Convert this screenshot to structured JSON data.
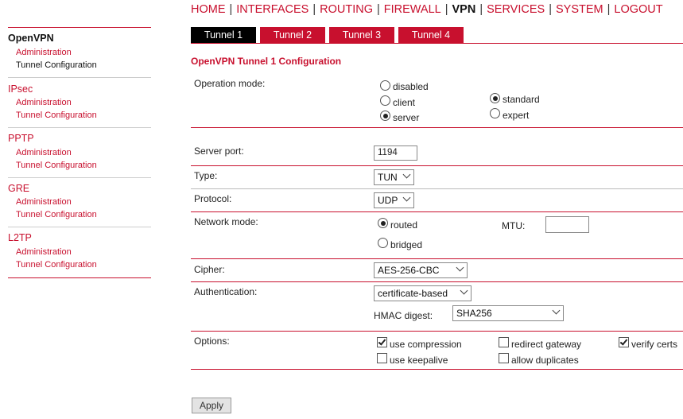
{
  "nav": {
    "items": [
      "HOME",
      "INTERFACES",
      "ROUTING",
      "FIREWALL",
      "VPN",
      "SERVICES",
      "SYSTEM",
      "LOGOUT"
    ],
    "active": "VPN"
  },
  "sidebar": {
    "openvpn": {
      "title": "OpenVPN",
      "admin": "Administration",
      "tunnel": "Tunnel Configuration"
    },
    "ipsec": {
      "title": "IPsec",
      "admin": "Administration",
      "tunnel": "Tunnel Configuration"
    },
    "pptp": {
      "title": "PPTP",
      "admin": "Administration",
      "tunnel": "Tunnel Configuration"
    },
    "gre": {
      "title": "GRE",
      "admin": "Administration",
      "tunnel": "Tunnel Configuration"
    },
    "l2tp": {
      "title": "L2TP",
      "admin": "Administration",
      "tunnel": "Tunnel Configuration"
    }
  },
  "tabs": [
    "Tunnel 1",
    "Tunnel 2",
    "Tunnel 3",
    "Tunnel 4"
  ],
  "page_title": "OpenVPN Tunnel 1 Configuration",
  "form": {
    "operation_mode": {
      "label": "Operation mode:",
      "disabled": "disabled",
      "client": "client",
      "server": "server",
      "standard": "standard",
      "expert": "expert"
    },
    "server_port": {
      "label": "Server port:",
      "value": "1194"
    },
    "type": {
      "label": "Type:",
      "value": "TUN"
    },
    "protocol": {
      "label": "Protocol:",
      "value": "UDP"
    },
    "network_mode": {
      "label": "Network mode:",
      "routed": "routed",
      "bridged": "bridged",
      "mtu_label": "MTU:",
      "mtu_value": ""
    },
    "cipher": {
      "label": "Cipher:",
      "value": "AES-256-CBC"
    },
    "authentication": {
      "label": "Authentication:",
      "value": "certificate-based",
      "hmac_label": "HMAC digest:",
      "hmac_value": "SHA256"
    },
    "options": {
      "label": "Options:",
      "use_compression": "use compression",
      "redirect_gateway": "redirect gateway",
      "verify_certs": "verify certs",
      "use_keepalive": "use keepalive",
      "allow_duplicates": "allow duplicates"
    }
  },
  "apply_label": "Apply",
  "colors": {
    "accent": "#c8102e",
    "active_tab": "#000000"
  }
}
